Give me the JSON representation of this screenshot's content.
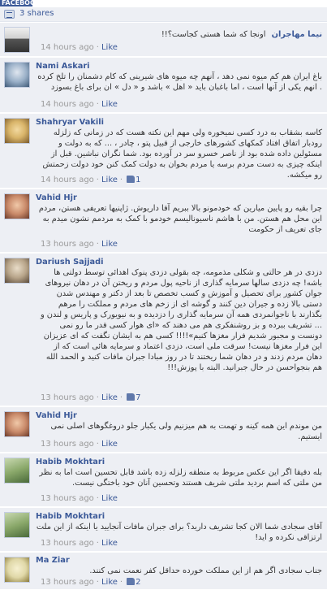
{
  "header": {
    "tab_label": "FACEBOOK",
    "shares": "3 shares"
  },
  "meta_labels": {
    "like": "Like",
    "separator": "·"
  },
  "comments": [
    {
      "author": "نیما مهاجران",
      "text": "اونجا که شما هستی کجاست؟!!",
      "time": "14 hours ago",
      "likes": "",
      "avatar_colors": [
        "#e8e8e8",
        "#555555"
      ]
    },
    {
      "author": "Nami Askari",
      "text": "باغ ایران هم کم میوه نمی دهد ، آنهم چه میوه های شیرینی که کام دشمنان را تلخ کرده . انهم یکی از آنها است ، اما باغبان باید « اهل » باشد و « دل » ان برای باغ بسوزد",
      "time": "14 hours ago",
      "likes": "",
      "avatar_colors": [
        "#9ab0c8",
        "#3f5a78"
      ]
    },
    {
      "author": "Shahryar Vakili",
      "text": "کاسه بشقاب به درد کسی نمیخوره ولی مهم این نکته هست که در زمانی که زلزله رودبار اتفاق افتاد کمکهای کشورهای خارجی از قبیل پتو ، چادر ، ... که به دولت و مسئولین داده شده بود از ناصر خسرو سر در آورده بود. شما نگران نباشین. قبل از اینکه چیزی به دست مردم برسه یا مردم بخوان به دولت کمک کنن خود دولت زحمتش رو میکشه.",
      "time": "14 hours ago",
      "likes": "1",
      "avatar_colors": [
        "#d9b56a",
        "#7a5a2c"
      ]
    },
    {
      "author": "Vahid Hjr",
      "text": "چرا بقیه رو پایین میارین که خودمونو بالا ببریم آقا داریوش. ژاپنیها تعریفی هستن، مردم این محل هم هستن. من با هاشم ناسیونالیسم خودمو با کمک به مردمم نشون میدم به جای تعریف از حکومت",
      "time": "13 hours ago",
      "likes": "",
      "avatar_colors": [
        "#c98a6a",
        "#6b3a2a"
      ]
    },
    {
      "author": "Dariush Sajjadi",
      "text": "دزدی در هر حالتی و شکلی مذمومه، چه بقولی دزدی پنوک اهدائی توسط دولتی ها باشه! چه دزدی سالها سرمایه گذاری از ناحیه پول مردم و ریختن آن در دهان نیروهای جوان کشور برای تحصیل و آموزش و کسب تخصص تا بعد از دکتر و مهندس شدن دستی بالا زده و جیران دین کنند و گوشه ای از زخم های مردم و مملکت را مرهم بگذارند با ناجوانمردی همه آن سرمایه گذاری را دزدیده و به نیویورک و پاریس و لندن و ... تشریف ببرده و بز روشنفکری هم می دهند که «ای هوار کسی قدر ما رو نمی دونست و مجبور شدیم فرار مغزها کنیم»!!!! کسی هم به ایشان نگفت که ای عزیزان این فرار مغزها نیست! سرقت ملی است، دزدی اعتماد و سرمایه هائی است که از دهان مردم زدند و در دهان شما ریختند تا در روز مبادا جبران مافات کنید و الحمد الله هم بنجواحسن در حال جبرانید. البته با پوزش!!!",
      "time": "13 hours ago",
      "likes": "7",
      "avatar_colors": [
        "#b8a58a",
        "#5a4a3a"
      ]
    },
    {
      "author": "Vahid Hjr",
      "text": "من موندم این همه کینه و تهمت به هم میزنیم ولی یکبار جلو دروغگوهای اصلی نمی ایستیم.",
      "time": "13 hours ago",
      "likes": "",
      "avatar_colors": [
        "#c98a6a",
        "#6b3a2a"
      ]
    },
    {
      "author": "Habib Mokhtari",
      "text": "بله دقیقا اگر این عکس مربوط به منطقه زلزله زده باشد قابل تحسین است اما به نظر من ملتی که اسم بردید ملتی شریف هستند وتحسین آنان خود باختگی نیست.",
      "time": "13 hours ago",
      "likes": "",
      "avatar_colors": [
        "#8aa86a",
        "#4a6a3a"
      ]
    },
    {
      "author": "Habib Mokhtari",
      "text": "آقای سجادی شما الان کجا تشریف دارید؟ برای جبران مافات آنجایید یا اینکه از این ملت ارتزاقی نکرده و اید!",
      "time": "13 hours ago",
      "likes": "",
      "avatar_colors": [
        "#8aa86a",
        "#4a6a3a"
      ]
    },
    {
      "author": "Ma Ziar",
      "text": "جناب سجادی اگر هم از این مملکت خورده حداقل کفر نعمت نمی کنند.",
      "time": "13 hours ago",
      "likes": "2",
      "avatar_colors": [
        "#e0d8a8",
        "#8a7a3a"
      ]
    }
  ]
}
